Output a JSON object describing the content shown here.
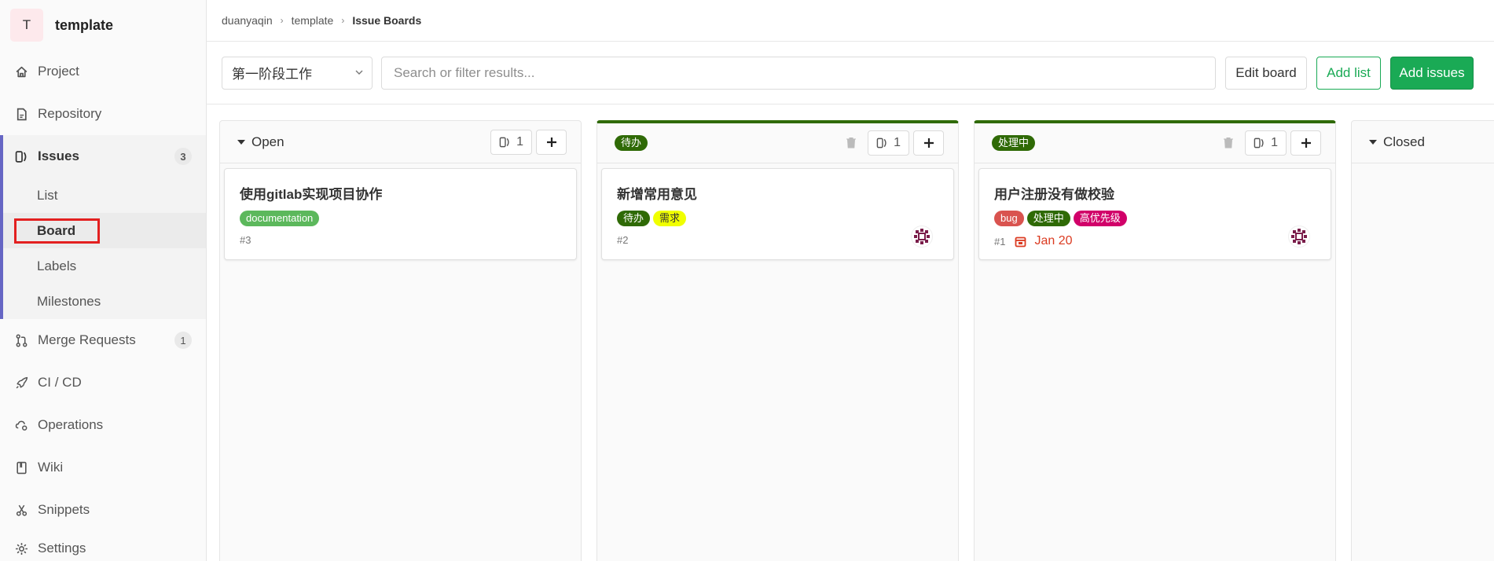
{
  "project": {
    "avatar_letter": "T",
    "name": "template"
  },
  "nav": {
    "project": "Project",
    "repository": "Repository",
    "issues": {
      "label": "Issues",
      "count": "3",
      "sub": {
        "list": "List",
        "board": "Board",
        "labels": "Labels",
        "milestones": "Milestones"
      }
    },
    "merge_requests": {
      "label": "Merge Requests",
      "count": "1"
    },
    "cicd": "CI / CD",
    "operations": "Operations",
    "wiki": "Wiki",
    "snippets": "Snippets",
    "settings": "Settings"
  },
  "breadcrumb": {
    "owner": "duanyaqin",
    "project": "template",
    "current": "Issue Boards"
  },
  "toolbar": {
    "board_name": "第一阶段工作",
    "search_placeholder": "Search or filter results...",
    "edit_board": "Edit board",
    "add_list": "Add list",
    "add_issues": "Add issues"
  },
  "colors": {
    "accent_green": "#1aaa55",
    "label_dark_green": "#2f6a06",
    "label_doc_green": "#5cb85c",
    "label_yellow": "#f0ff00",
    "label_bug": "#d9534f",
    "label_priority": "#d10069",
    "active_highlight": "#e32020"
  },
  "lists": [
    {
      "title": "Open",
      "count": "1",
      "card": {
        "title": "使用gitlab实现项目协作",
        "labels": [
          "documentation"
        ],
        "ref": "#3"
      }
    },
    {
      "label": "待办",
      "count": "1",
      "card": {
        "title": "新增常用意见",
        "labels": [
          "待办",
          "需求"
        ],
        "ref": "#2"
      }
    },
    {
      "label": "处理中",
      "count": "1",
      "card": {
        "title": "用户注册没有做校验",
        "labels": [
          "bug",
          "处理中",
          "高优先级"
        ],
        "ref": "#1",
        "due": "Jan 20"
      }
    },
    {
      "title": "Closed"
    }
  ]
}
